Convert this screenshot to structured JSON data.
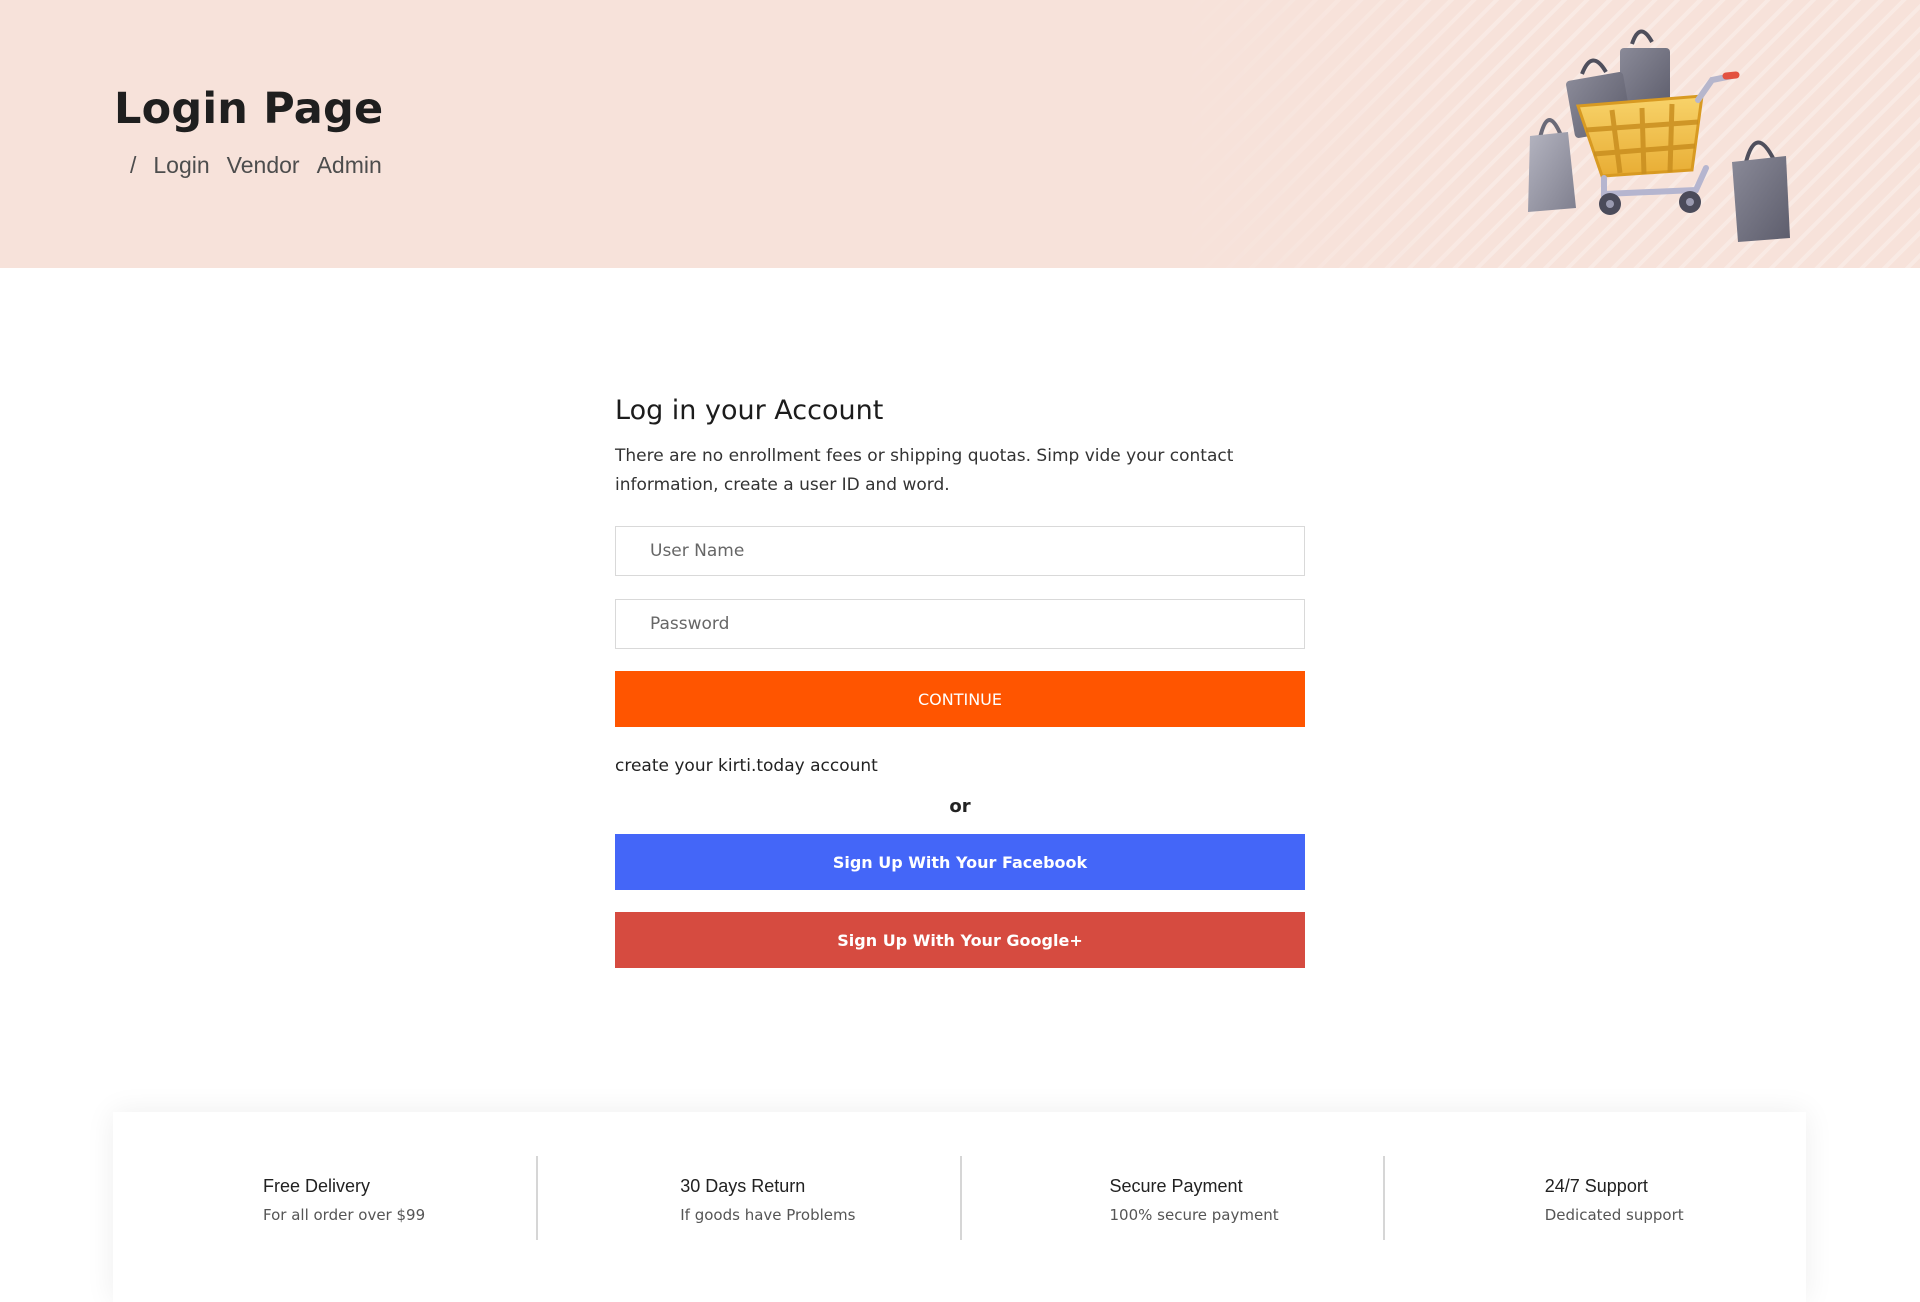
{
  "header": {
    "title": "Login Page",
    "breadcrumb": {
      "separator": "/",
      "items": [
        "Login",
        "Vendor",
        "Admin"
      ]
    },
    "illustration": "shopping-cart-with-bags-illustration"
  },
  "login": {
    "heading": "Log in your Account",
    "description": "There are no enrollment fees or shipping quotas. Simp vide your contact information, create a user ID and word.",
    "username_placeholder": "User Name",
    "password_placeholder": "Password",
    "continue_label": "CONTINUE",
    "create_account_text": "create your kirti.today account",
    "or_text": "or",
    "facebook_label": "Sign Up With Your Facebook",
    "google_label": "Sign Up With Your Google+"
  },
  "features": [
    {
      "title": "Free Delivery",
      "subtitle": "For all order over $99"
    },
    {
      "title": "30 Days Return",
      "subtitle": "If goods have Problems"
    },
    {
      "title": "Secure Payment",
      "subtitle": "100% secure payment"
    },
    {
      "title": "24/7 Support",
      "subtitle": "Dedicated support"
    }
  ],
  "colors": {
    "banner_background": "#f7e2da",
    "continue_button": "#ff5500",
    "facebook_button": "#4466f8",
    "google_button": "#d64b40"
  }
}
